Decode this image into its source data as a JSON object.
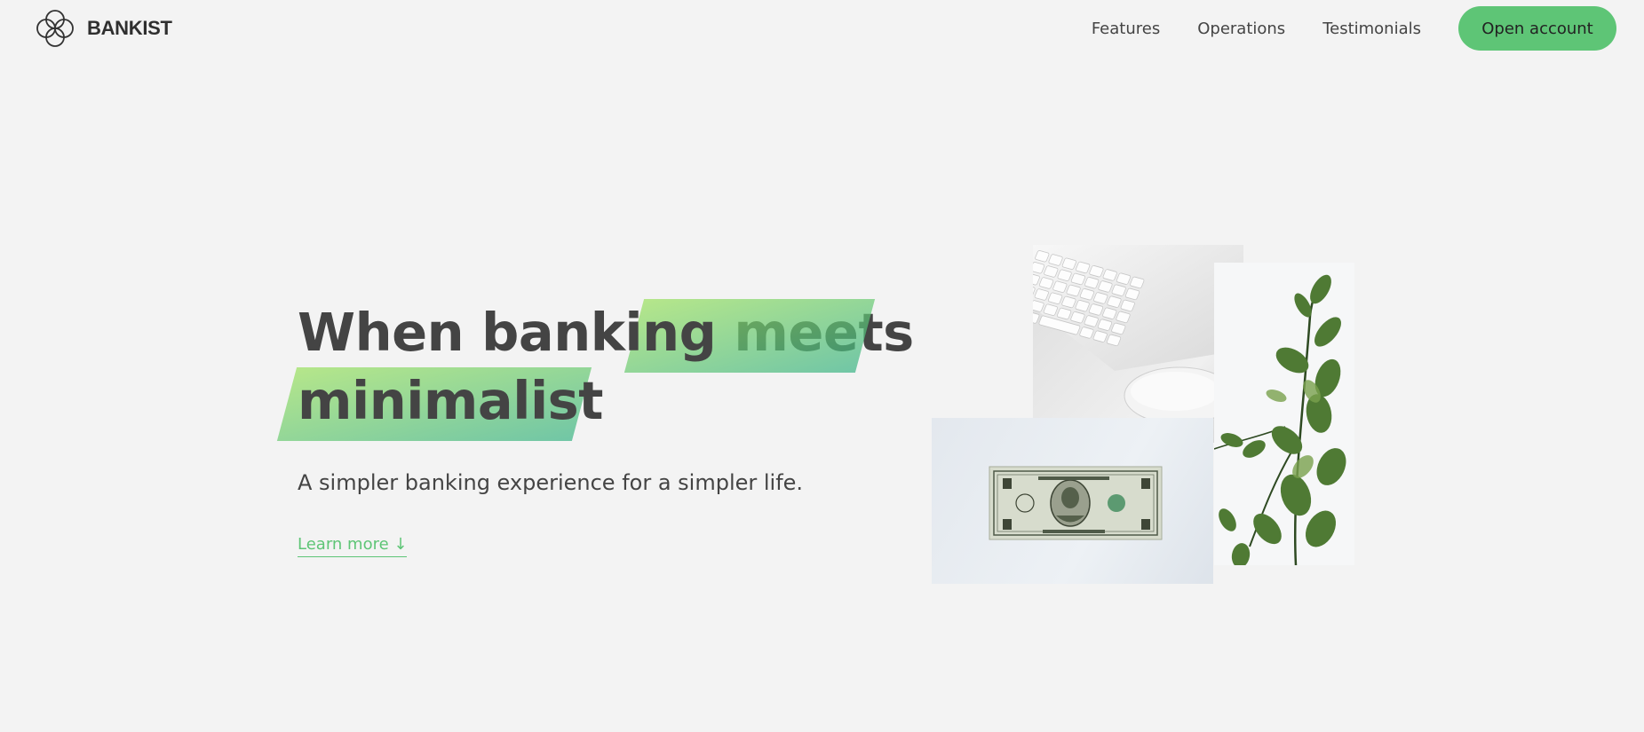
{
  "brand": {
    "name": "BANKIST"
  },
  "nav": {
    "links": [
      "Features",
      "Operations",
      "Testimonials"
    ],
    "cta_label": "Open account"
  },
  "hero": {
    "headline": {
      "line1_before": "When ",
      "line1_highlight": "banking",
      "line1_after": " meets",
      "line2_highlight": "minimalist"
    },
    "subtitle": "A simpler banking experience for a simpler life.",
    "learn_more": "Learn more ↓"
  },
  "colors": {
    "background": "#f3f3f3",
    "accent": "#5ec576",
    "gradient_start": "#9be15d",
    "gradient_end": "#39b385",
    "text": "#444444"
  },
  "images": [
    {
      "name": "keyboard-mouse-photo"
    },
    {
      "name": "dollar-bill-photo"
    },
    {
      "name": "eucalyptus-plant-photo"
    }
  ]
}
